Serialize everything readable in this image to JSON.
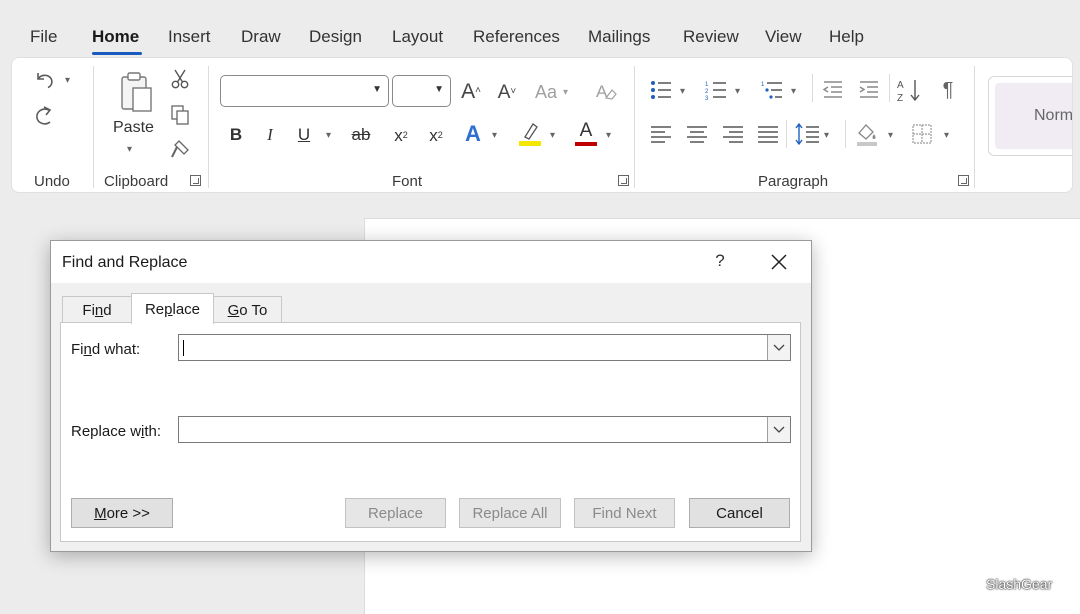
{
  "menu": {
    "tabs": [
      {
        "label": "File"
      },
      {
        "label": "Home"
      },
      {
        "label": "Insert"
      },
      {
        "label": "Draw"
      },
      {
        "label": "Design"
      },
      {
        "label": "Layout"
      },
      {
        "label": "References"
      },
      {
        "label": "Mailings"
      },
      {
        "label": "Review"
      },
      {
        "label": "View"
      },
      {
        "label": "Help"
      }
    ],
    "active": "Home"
  },
  "ribbon": {
    "groups": {
      "undo": "Undo",
      "clipboard": "Clipboard",
      "font": "Font",
      "paragraph": "Paragraph"
    },
    "paste_label": "Paste",
    "font_grow": "A",
    "font_shrink": "A",
    "change_case": "Aa",
    "bold": "B",
    "italic": "I",
    "underline": "U",
    "strikethrough": "ab",
    "subscript": "x",
    "subscript_mark": "2",
    "superscript": "x",
    "superscript_mark": "2",
    "text_effects": "A",
    "font_color": "A",
    "style_preview": "Norm",
    "colors": {
      "highlight": "#f3e600",
      "font_color": "#c00000",
      "accent": "#185abd",
      "text_effect": "#2f6fcf"
    }
  },
  "dialog": {
    "title": "Find and Replace",
    "help": "?",
    "tabs": {
      "find": {
        "pre": "Fi",
        "key": "n",
        "post": "d"
      },
      "replace": {
        "pre": "Re",
        "key": "p",
        "post": "lace"
      },
      "goto": {
        "pre": "",
        "key": "G",
        "post": "o To"
      }
    },
    "active_tab": "Replace",
    "find_label": {
      "pre": "Fi",
      "key": "n",
      "post": "d what:"
    },
    "replace_label": {
      "pre": "Replace w",
      "key": "i",
      "post": "th:"
    },
    "find_value": "",
    "replace_value": "",
    "buttons": {
      "more": {
        "key": "M",
        "post": "ore >>"
      },
      "replace": "Replace",
      "replace_all": "Replace All",
      "find_next": "Find Next",
      "cancel": "Cancel"
    }
  },
  "watermark": "SlashGear"
}
